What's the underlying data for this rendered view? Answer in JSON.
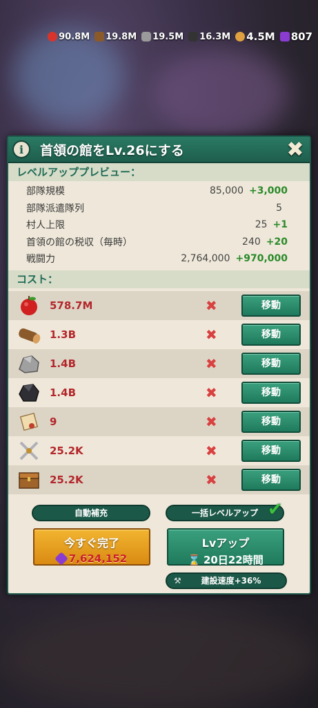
{
  "resources": [
    {
      "name": "food",
      "value": "90.8M",
      "icon": "apple-icon",
      "color": "#d9342b"
    },
    {
      "name": "wood",
      "value": "19.8M",
      "icon": "log-icon",
      "color": "#8b5a2b"
    },
    {
      "name": "stone",
      "value": "19.5M",
      "icon": "stone-icon",
      "color": "#9a9a9a"
    },
    {
      "name": "ore",
      "value": "16.3M",
      "icon": "ore-icon",
      "color": "#333"
    },
    {
      "name": "gold",
      "value": "4.5M",
      "icon": "coin-icon",
      "color": "#e0a040"
    },
    {
      "name": "gems",
      "value": "807",
      "icon": "gem-icon",
      "color": "#8a3cd0"
    }
  ],
  "dialog": {
    "title": "首領の館をLv.26にする",
    "preview_heading": "レベルアッププレビュー：",
    "stats": [
      {
        "label": "部隊規模",
        "value": "85,000",
        "plus": "+3,000"
      },
      {
        "label": "部隊派遣隊列",
        "value": "5",
        "plus": ""
      },
      {
        "label": "村人上限",
        "value": "25",
        "plus": "+1"
      },
      {
        "label": "首領の館の税収（毎時）",
        "value": "240",
        "plus": "+20"
      },
      {
        "label": "戦闘力",
        "value": "2,764,000",
        "plus": "+970,000"
      }
    ],
    "cost_heading": "コスト：",
    "costs": [
      {
        "icon": "apple-icon",
        "amount": "578.7M",
        "button": "移動"
      },
      {
        "icon": "log-icon",
        "amount": "1.3B",
        "button": "移動"
      },
      {
        "icon": "stone-icon",
        "amount": "1.4B",
        "button": "移動"
      },
      {
        "icon": "ore-icon",
        "amount": "1.4B",
        "button": "移動"
      },
      {
        "icon": "scroll-icon",
        "amount": "9",
        "button": "移動"
      },
      {
        "icon": "crossed-swords-icon",
        "amount": "25.2K",
        "button": "移動"
      },
      {
        "icon": "treasure-chest-icon",
        "amount": "25.2K",
        "button": "移動"
      }
    ],
    "auto_refill_label": "自動補充",
    "bulk_levelup_label": "一括レベルアップ",
    "finish_now": {
      "label": "今すぐ完了",
      "cost": "7,624,152"
    },
    "level_up": {
      "label": "Lvアップ",
      "time": "20日22時間"
    },
    "build_speed": "建設速度+36%"
  },
  "colors": {
    "accent": "#1e6a55",
    "cost_red": "#b3262b",
    "plus_green": "#2a8a2a",
    "gold_button": "#f2b531"
  }
}
